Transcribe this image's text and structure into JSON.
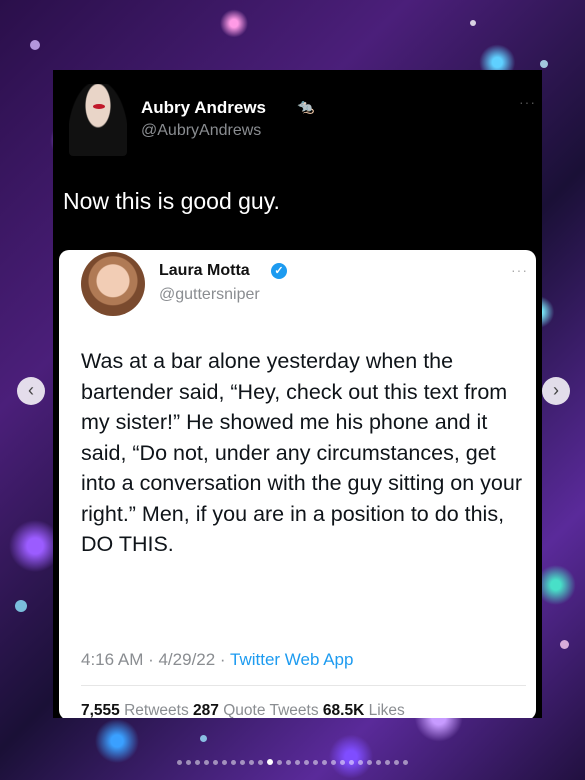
{
  "outer_tweet": {
    "author_name": "Aubry Andrews",
    "author_handle": "@AubryAndrews",
    "text": "Now this is good guy."
  },
  "quoted_tweet": {
    "author_name": "Laura Motta",
    "author_handle": "@guttersniper",
    "text": "Was at a bar alone yesterday when the bartender said, “Hey, check out this text from my sister!” He showed me his phone and it said, “Do not, under any circumstances, get into a conversation with the guy sitting on your right.” Men, if you are in a position to do this, DO THIS.",
    "time": "4:16 AM · 4/29/22 · ",
    "app": "Twitter Web App",
    "retweets_count": "7,555",
    "retweets_label": "Retweets",
    "quote_count": "287",
    "quote_label": "Quote Tweets",
    "likes_count": "68.5K",
    "likes_label": "Likes"
  },
  "carousel": {
    "prev_icon": "‹",
    "next_icon": "›",
    "dot_count": 26,
    "active_index": 10
  },
  "icons": {
    "more": "···",
    "verified": "✓",
    "rat": "🐀"
  },
  "colors": {
    "accent": "#1d9bf0"
  }
}
